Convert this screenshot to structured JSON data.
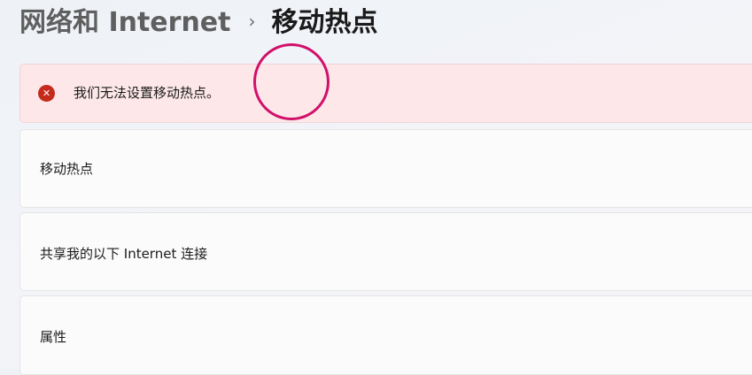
{
  "breadcrumb": {
    "parent": "网络和 Internet",
    "separator": "›",
    "current": "移动热点"
  },
  "error": {
    "icon": "error-icon",
    "icon_glyph": "✕",
    "message": "我们无法设置移动热点。",
    "color": "#c42b1c",
    "background": "#fde7e9"
  },
  "settings": [
    {
      "label": "移动热点"
    },
    {
      "label": "共享我的以下 Internet 连接"
    },
    {
      "label": "属性"
    }
  ],
  "annotation": {
    "color": "#d1106a"
  }
}
